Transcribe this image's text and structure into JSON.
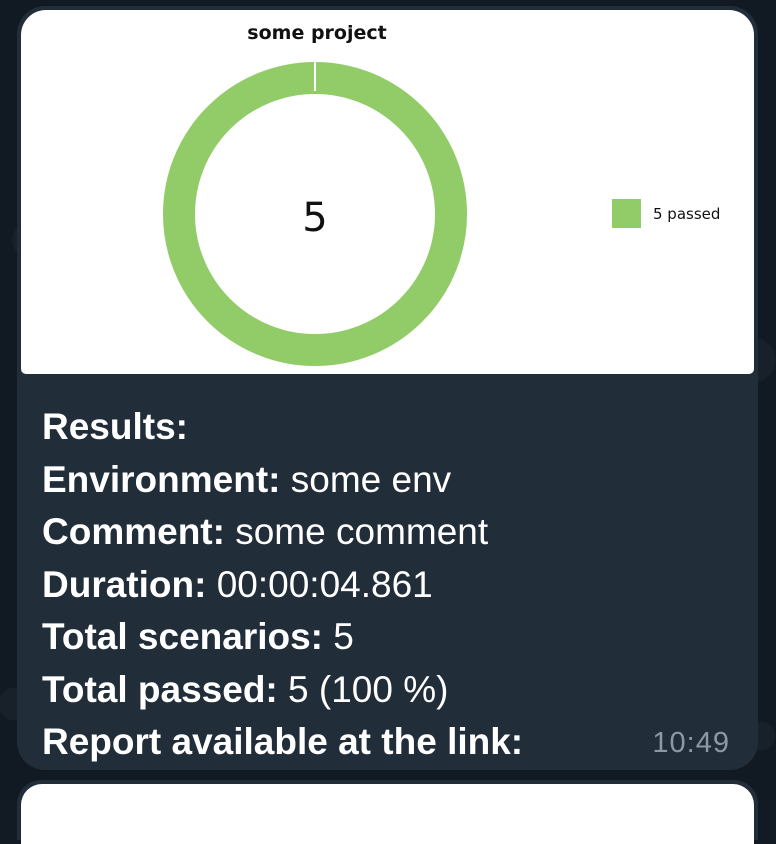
{
  "chart_data": {
    "type": "pie",
    "title": "some project",
    "categories": [
      "5 passed"
    ],
    "values": [
      5
    ],
    "center_label": "5",
    "legend_position": "right",
    "colors": [
      "#92cc68"
    ]
  },
  "message": {
    "lines": [
      {
        "label": "Results:",
        "value": ""
      },
      {
        "label": "Environment:",
        "value": " some env"
      },
      {
        "label": "Comment:",
        "value": " some comment"
      },
      {
        "label": "Duration:",
        "value": " 00:00:04.861"
      },
      {
        "label": "Total scenarios:",
        "value": " 5"
      },
      {
        "label": "Total passed:",
        "value": " 5 (100 %)"
      },
      {
        "label": "Report available at the link:",
        "value": ""
      }
    ],
    "time": "10:49"
  },
  "theme": {
    "bubble_color": "#222d3a",
    "background_color": "#111a23",
    "passed_color": "#92cc68",
    "timestamp_color": "#8d98a4"
  }
}
